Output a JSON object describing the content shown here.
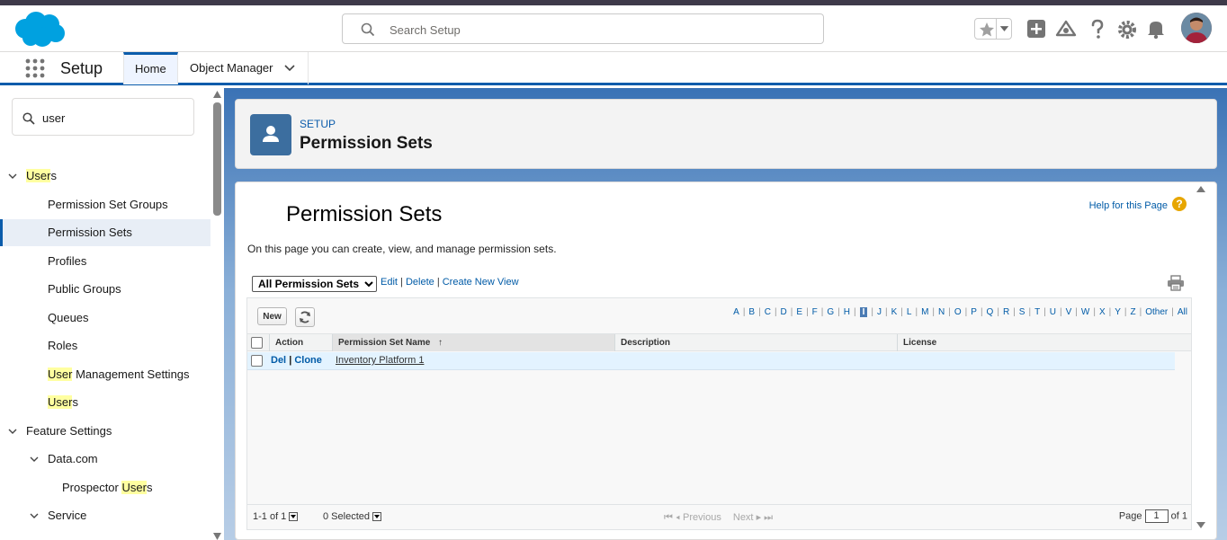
{
  "header": {
    "search_placeholder": "Search Setup"
  },
  "nav": {
    "app_name": "Setup",
    "tabs": [
      {
        "label": "Home"
      },
      {
        "label": "Object Manager"
      }
    ]
  },
  "sidebar": {
    "quickfind_value": "user",
    "items": [
      {
        "pre": "",
        "hl": "User",
        "post": "s"
      },
      {
        "label": "Permission Set Groups"
      },
      {
        "label": "Permission Sets"
      },
      {
        "label": "Profiles"
      },
      {
        "label": "Public Groups"
      },
      {
        "label": "Queues"
      },
      {
        "label": "Roles"
      },
      {
        "pre": "",
        "hl": "User",
        "post": " Management Settings"
      },
      {
        "pre": "",
        "hl": "User",
        "post": "s"
      },
      {
        "label": "Feature Settings"
      },
      {
        "label": "Data.com"
      },
      {
        "pre": "Prospector ",
        "hl": "User",
        "post": "s"
      },
      {
        "label": "Service"
      }
    ]
  },
  "page_header": {
    "eyebrow": "SETUP",
    "title": "Permission Sets"
  },
  "content": {
    "title": "Permission Sets",
    "help_link": "Help for this Page",
    "help_icon": "?",
    "description": "On this page you can create, view, and manage permission sets.",
    "view_select": "All Permission Sets",
    "view_links": {
      "edit": "Edit",
      "delete": "Delete",
      "create": "Create New View",
      "sep": "|"
    },
    "new_button": "New",
    "alphabet": [
      "A",
      "B",
      "C",
      "D",
      "E",
      "F",
      "G",
      "H",
      "I",
      "J",
      "K",
      "L",
      "M",
      "N",
      "O",
      "P",
      "Q",
      "R",
      "S",
      "T",
      "U",
      "V",
      "W",
      "X",
      "Y",
      "Z",
      "Other",
      "All"
    ],
    "alphabet_selected": "I",
    "columns": {
      "action": "Action",
      "name": "Permission Set Name",
      "sort_arrow": "↑",
      "description": "Description",
      "license": "License"
    },
    "rows": [
      {
        "del": "Del",
        "sep": "|",
        "clone": "Clone",
        "name": "Inventory Platform 1",
        "description": "",
        "license": ""
      }
    ],
    "pager": {
      "range": "1-1 of 1",
      "selected": "0 Selected",
      "previous": "Previous",
      "next": "Next",
      "page_label": "Page",
      "page_value": "1",
      "of_label": "of 1"
    }
  },
  "colors": {
    "brand_blue": "#0b5cab",
    "link_blue": "#015ba7",
    "highlight": "#ffffa0",
    "selected_row": "#e3f3ff"
  }
}
